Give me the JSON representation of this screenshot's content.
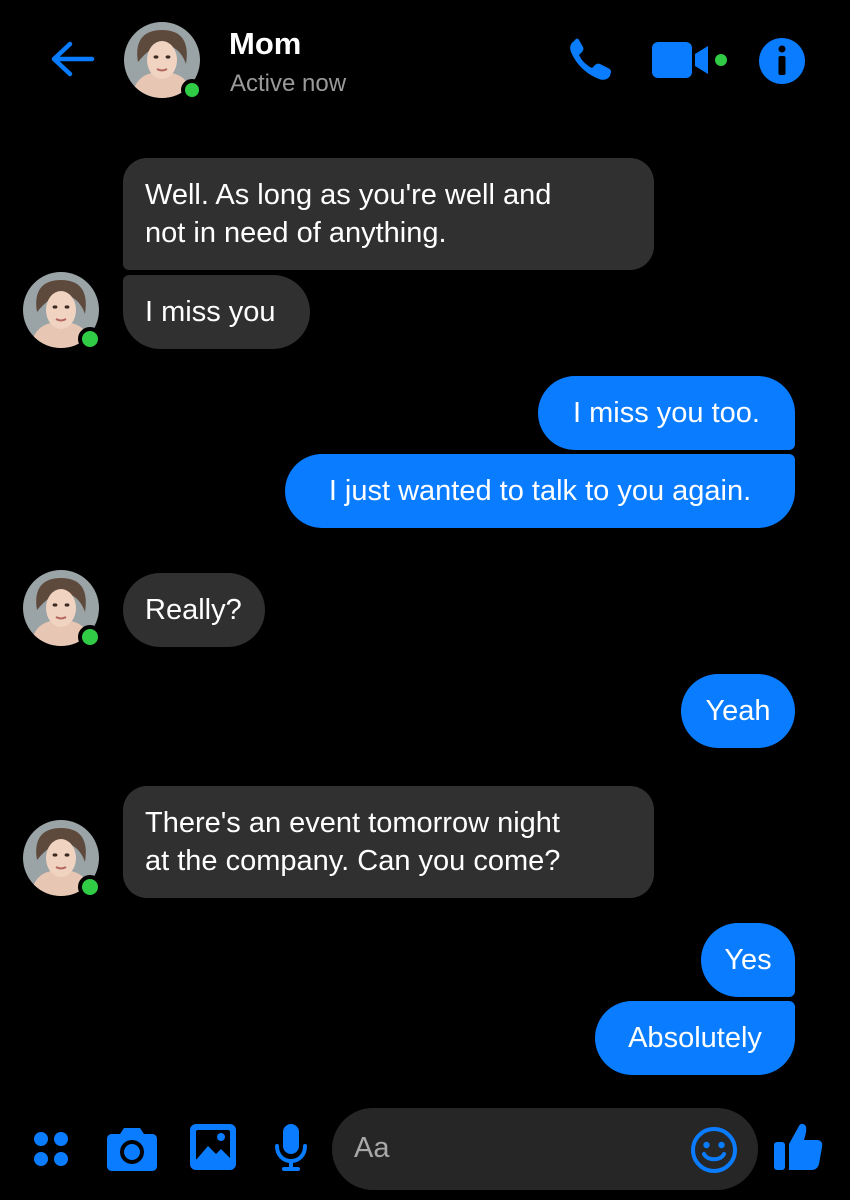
{
  "header": {
    "name": "Mom",
    "status": "Active now"
  },
  "messages": [
    {
      "sender": "Mom",
      "lines": [
        "Well. As long as you're well and",
        "not in need of anything."
      ]
    },
    {
      "sender": "Mom",
      "lines": [
        "I miss you"
      ]
    },
    {
      "sender": "me",
      "lines": [
        "I miss you too."
      ]
    },
    {
      "sender": "me",
      "lines": [
        "I just wanted to talk to you again."
      ]
    },
    {
      "sender": "Mom",
      "lines": [
        "Really?"
      ]
    },
    {
      "sender": "me",
      "lines": [
        "Yeah"
      ]
    },
    {
      "sender": "Mom",
      "lines": [
        "There's an event tomorrow night",
        "at the company. Can you come?"
      ]
    },
    {
      "sender": "me",
      "lines": [
        "Yes"
      ]
    },
    {
      "sender": "me",
      "lines": [
        "Absolutely"
      ]
    }
  ],
  "composer": {
    "placeholder": "Aa",
    "icons": [
      "apps-icon",
      "camera-icon",
      "gallery-icon",
      "microphone-icon",
      "emoji-icon",
      "thumbs-up-icon"
    ]
  },
  "colors": {
    "accent": "#0a7cff",
    "background": "#000000",
    "incoming_bubble": "#303030",
    "online": "#31cc46",
    "muted_text": "#9a9a9a"
  }
}
